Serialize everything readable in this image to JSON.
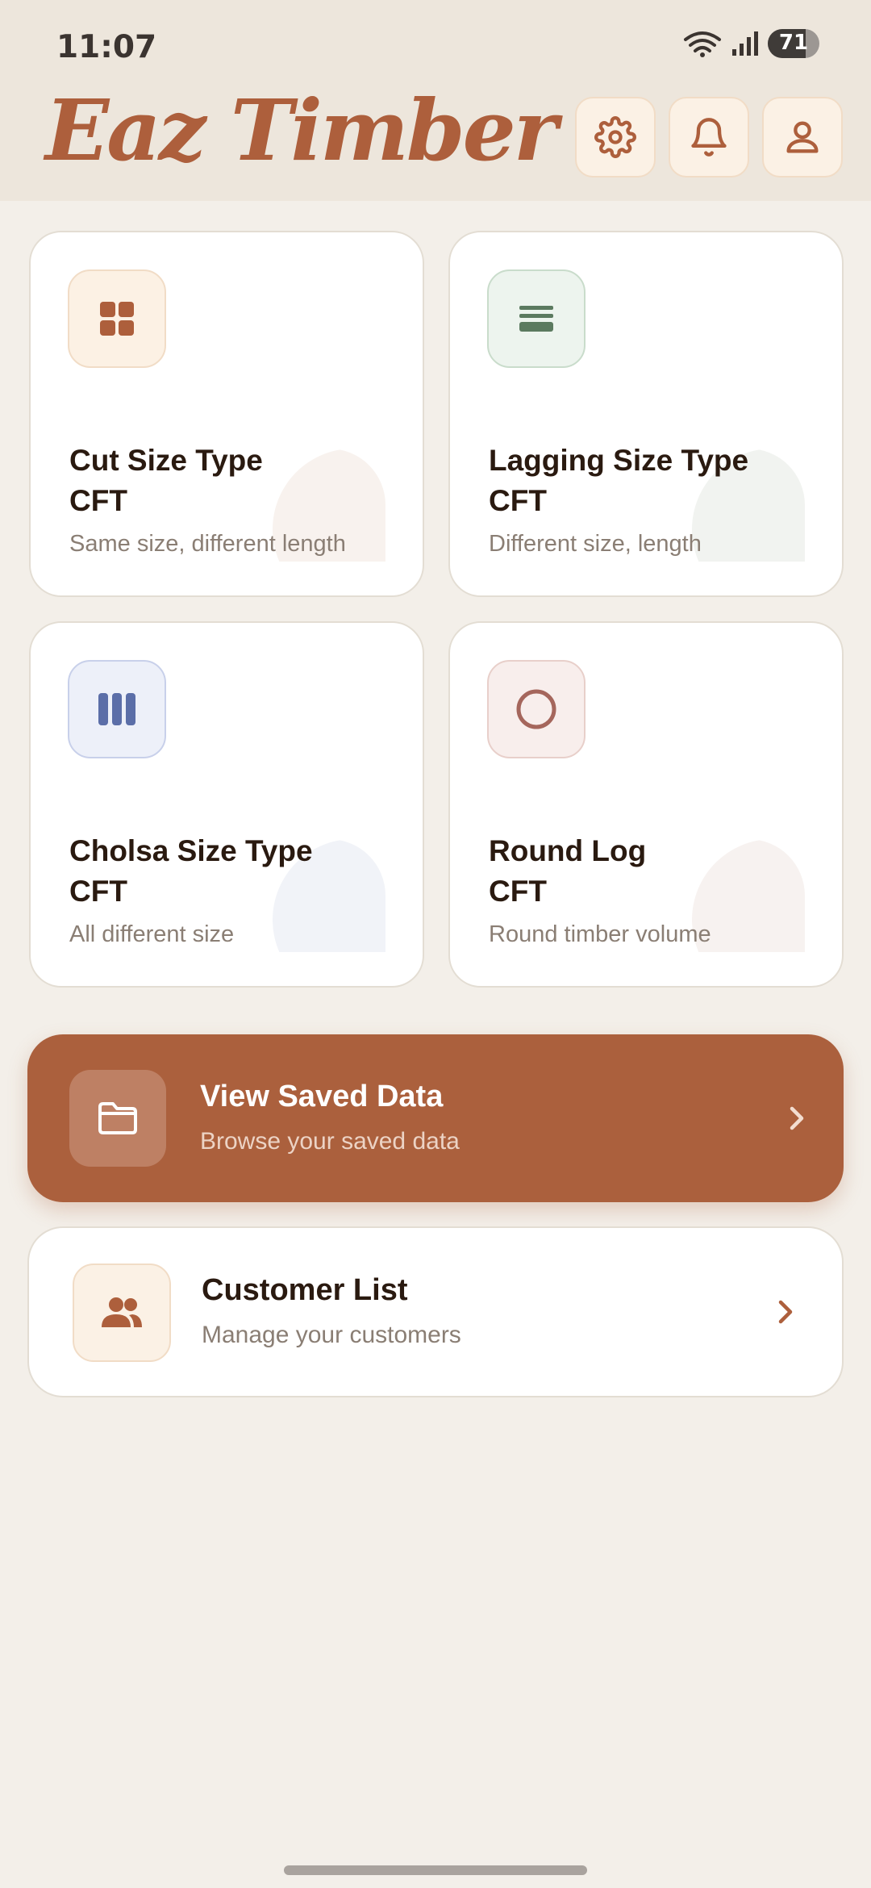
{
  "status_bar": {
    "time": "11:07",
    "battery": "71"
  },
  "header": {
    "brand": "Eaz Timber",
    "icons": [
      "gear-icon",
      "bell-icon",
      "user-icon"
    ]
  },
  "cards": [
    {
      "title_line1": "Cut Size Type",
      "title_line2": "CFT",
      "subtitle": "Same size, different length",
      "icon": "grid-icon",
      "accent": "#ad5f3c"
    },
    {
      "title_line1": "Lagging Size Type",
      "title_line2": "CFT",
      "subtitle": "Different size, length",
      "icon": "lines-icon",
      "accent": "#5b7a5f"
    },
    {
      "title_line1": "Cholsa Size Type",
      "title_line2": "CFT",
      "subtitle": "All different size",
      "icon": "bars-icon",
      "accent": "#5b6ea8"
    },
    {
      "title_line1": "Round Log",
      "title_line2": "CFT",
      "subtitle": "Round timber volume",
      "icon": "circle-icon",
      "accent": "#a5665c"
    }
  ],
  "saved_data": {
    "title": "View Saved Data",
    "subtitle": "Browse your saved data",
    "icon": "folder-icon"
  },
  "customer_list": {
    "title": "Customer List",
    "subtitle": "Manage your customers",
    "icon": "users-icon"
  },
  "colors": {
    "brand": "#ad5f3c",
    "background": "#f3efe9",
    "header_bg": "#ede6dc"
  }
}
